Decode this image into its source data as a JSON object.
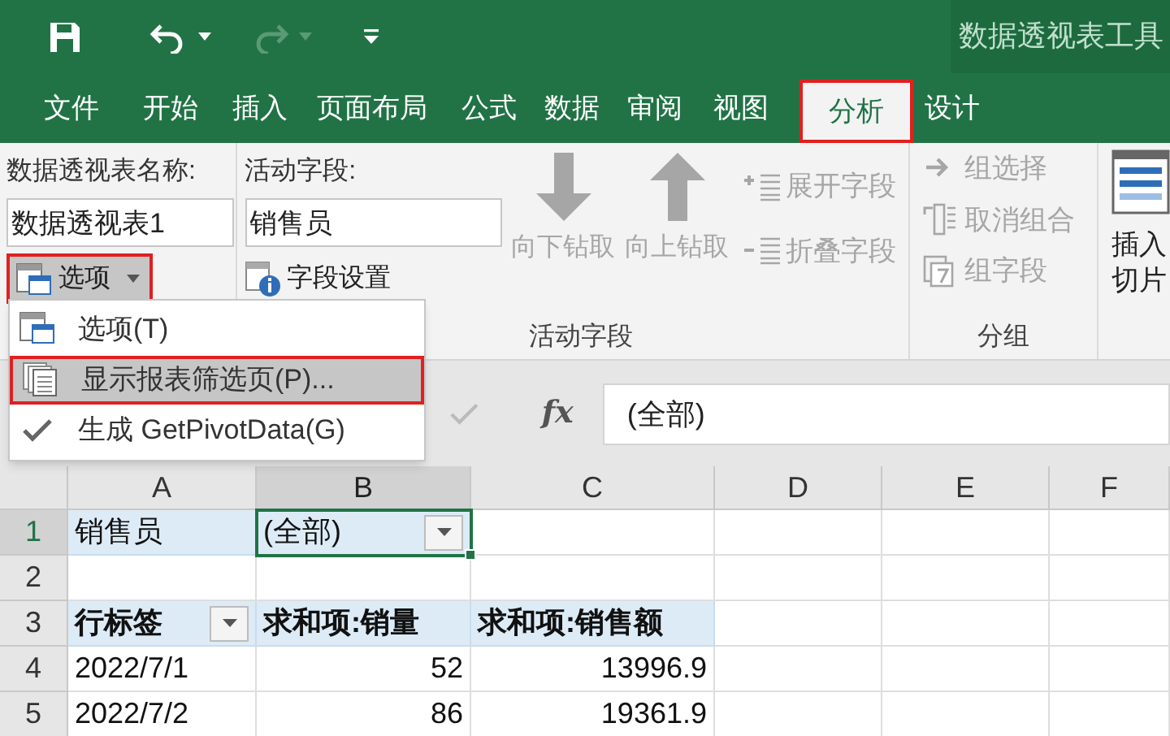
{
  "quick_access": {
    "redo_disabled": true
  },
  "context_title": "数据透视表工具",
  "tabs": [
    {
      "label": "文件",
      "selected": false,
      "outlined": false
    },
    {
      "label": "开始",
      "selected": false,
      "outlined": false
    },
    {
      "label": "插入",
      "selected": false,
      "outlined": false
    },
    {
      "label": "页面布局",
      "selected": false,
      "outlined": false
    },
    {
      "label": "公式",
      "selected": false,
      "outlined": false
    },
    {
      "label": "数据",
      "selected": false,
      "outlined": false
    },
    {
      "label": "审阅",
      "selected": false,
      "outlined": false
    },
    {
      "label": "视图",
      "selected": false,
      "outlined": false
    },
    {
      "label": "分析",
      "selected": true,
      "outlined": true
    },
    {
      "label": "设计",
      "selected": false,
      "outlined": false
    }
  ],
  "ribbon": {
    "pivot_name_label": "数据透视表名称:",
    "pivot_name": "数据透视表1",
    "options_button": {
      "label": "选项",
      "pressed": true,
      "outlined": true
    },
    "active_field_label": "活动字段:",
    "active_field": "销售员",
    "field_settings": "字段设置",
    "drill_buttons": [
      {
        "label": "向下钻取",
        "disabled": true
      },
      {
        "label": "向上钻取",
        "disabled": true
      }
    ],
    "field_buttons": [
      {
        "label": "展开字段",
        "disabled": true
      },
      {
        "label": "折叠字段",
        "disabled": true
      }
    ],
    "active_field_group": "活动字段",
    "group_buttons": [
      {
        "label": "组选择",
        "disabled": true
      },
      {
        "label": "取消组合",
        "disabled": true
      },
      {
        "label": "组字段",
        "disabled": true
      }
    ],
    "grouping_group": "分组",
    "slicer_lines": [
      "插入",
      "切片"
    ]
  },
  "menu": [
    {
      "kind": "options",
      "label": "选项(T)",
      "selected": false,
      "outlined": false
    },
    {
      "kind": "pages",
      "label": "显示报表筛选页(P)...",
      "selected": true,
      "outlined": true
    },
    {
      "kind": "toggle",
      "label": "生成 GetPivotData(G)",
      "selected": false,
      "outlined": false,
      "checked": true
    }
  ],
  "formula_bar": {
    "function_label": "fx",
    "value": "(全部)"
  },
  "columns": [
    {
      "label": "A",
      "selected": false
    },
    {
      "label": "B",
      "selected": true
    },
    {
      "label": "C",
      "selected": false
    },
    {
      "label": "D",
      "selected": false
    },
    {
      "label": "E",
      "selected": false
    },
    {
      "label": "F",
      "selected": false
    }
  ],
  "rows": [
    {
      "label": "1",
      "selected": true,
      "cells": [
        {
          "kind": "filter-label",
          "text": "销售员",
          "selected": false
        },
        {
          "kind": "filter-value",
          "text": "(全部)",
          "selected": true
        }
      ]
    },
    {
      "label": "2",
      "selected": false
    },
    {
      "label": "3",
      "selected": false,
      "cells": [
        {
          "kind": "header-filter",
          "text": "行标签",
          "selected": false
        },
        {
          "kind": "header",
          "text": "求和项:销量",
          "selected": false
        },
        {
          "kind": "header",
          "text": "求和项:销售额",
          "selected": false
        }
      ]
    },
    {
      "label": "4",
      "selected": false,
      "cells": [
        {
          "kind": "text",
          "text": "2022/7/1",
          "selected": false
        },
        {
          "kind": "number",
          "text": "52",
          "selected": false
        },
        {
          "kind": "number",
          "text": "13996.9",
          "selected": false
        }
      ]
    },
    {
      "label": "5",
      "selected": false,
      "cells": [
        {
          "kind": "text",
          "text": "2022/7/2",
          "selected": false
        },
        {
          "kind": "number",
          "text": "86",
          "selected": false
        },
        {
          "kind": "number",
          "text": "19361.9",
          "selected": false
        }
      ]
    }
  ]
}
